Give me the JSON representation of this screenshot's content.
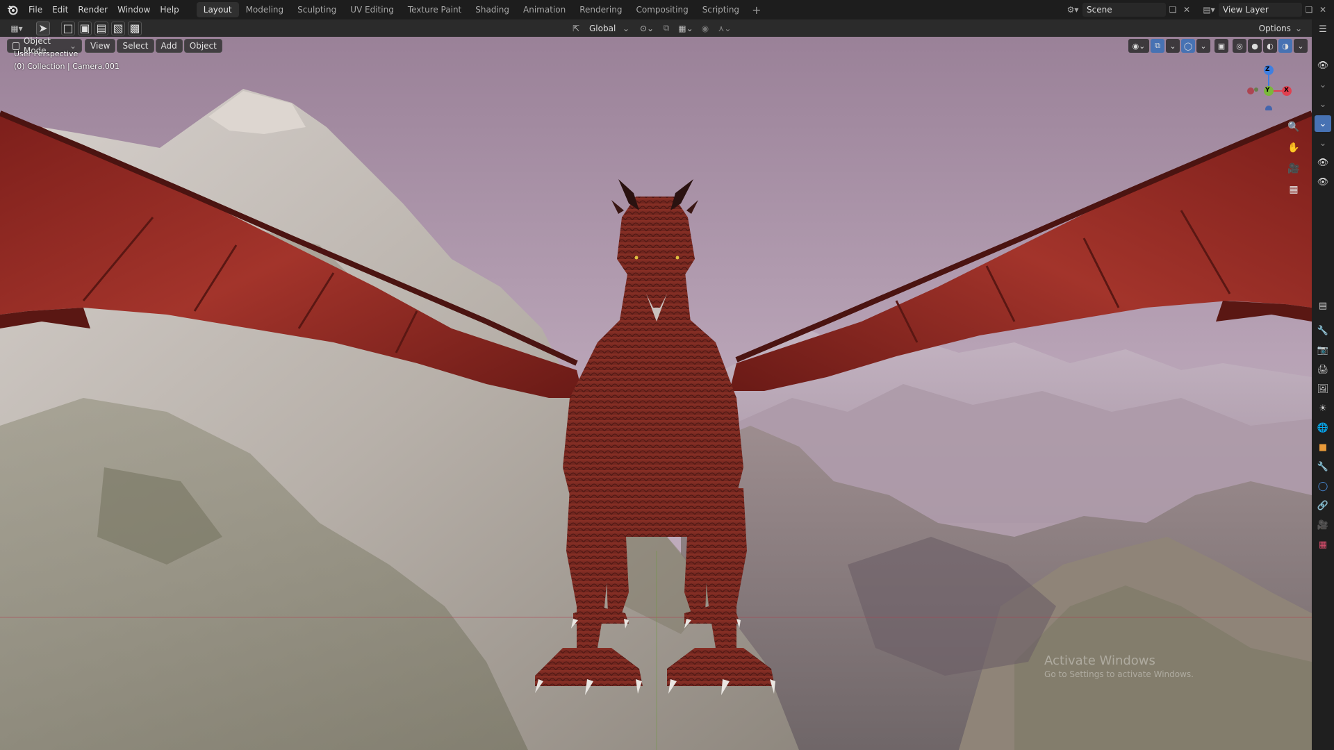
{
  "topbar": {
    "menus": [
      "File",
      "Edit",
      "Render",
      "Window",
      "Help"
    ],
    "workspaces": [
      "Layout",
      "Modeling",
      "Sculpting",
      "UV Editing",
      "Texture Paint",
      "Shading",
      "Animation",
      "Rendering",
      "Compositing",
      "Scripting"
    ],
    "active_workspace": "Layout",
    "add_workspace": "+",
    "scene_name": "Scene",
    "view_layer_name": "View Layer"
  },
  "header": {
    "transform_orientation": "Global",
    "options_label": "Options"
  },
  "viewport": {
    "mode_label": "Object Mode",
    "menus": [
      "View",
      "Select",
      "Add",
      "Object"
    ],
    "info_line1": "User Perspective",
    "info_line2": "(0) Collection | Camera.001",
    "gizmo": {
      "z": "Z",
      "y": "Y",
      "x": "X"
    }
  },
  "watermark": {
    "line1": "Activate Windows",
    "line2": "Go to Settings to activate Windows."
  },
  "colors": {
    "accent": "#4772b3",
    "axis_x": "#e0404f",
    "axis_y": "#7ab83a",
    "axis_z": "#3f7fe0",
    "dragon_red": "#8a2a22",
    "sky": "#b7a3b5"
  },
  "icons": {
    "right_strip": [
      "outliner-icon",
      "eye-icon",
      "eye-icon",
      "eye-icon",
      "eye-icon",
      "properties-icon",
      "tool-icon",
      "render-icon",
      "output-icon",
      "view-layer-icon",
      "scene-icon",
      "world-icon",
      "object-icon",
      "modifier-icon",
      "physics-icon",
      "constraint-icon",
      "data-icon",
      "texture-icon"
    ]
  }
}
